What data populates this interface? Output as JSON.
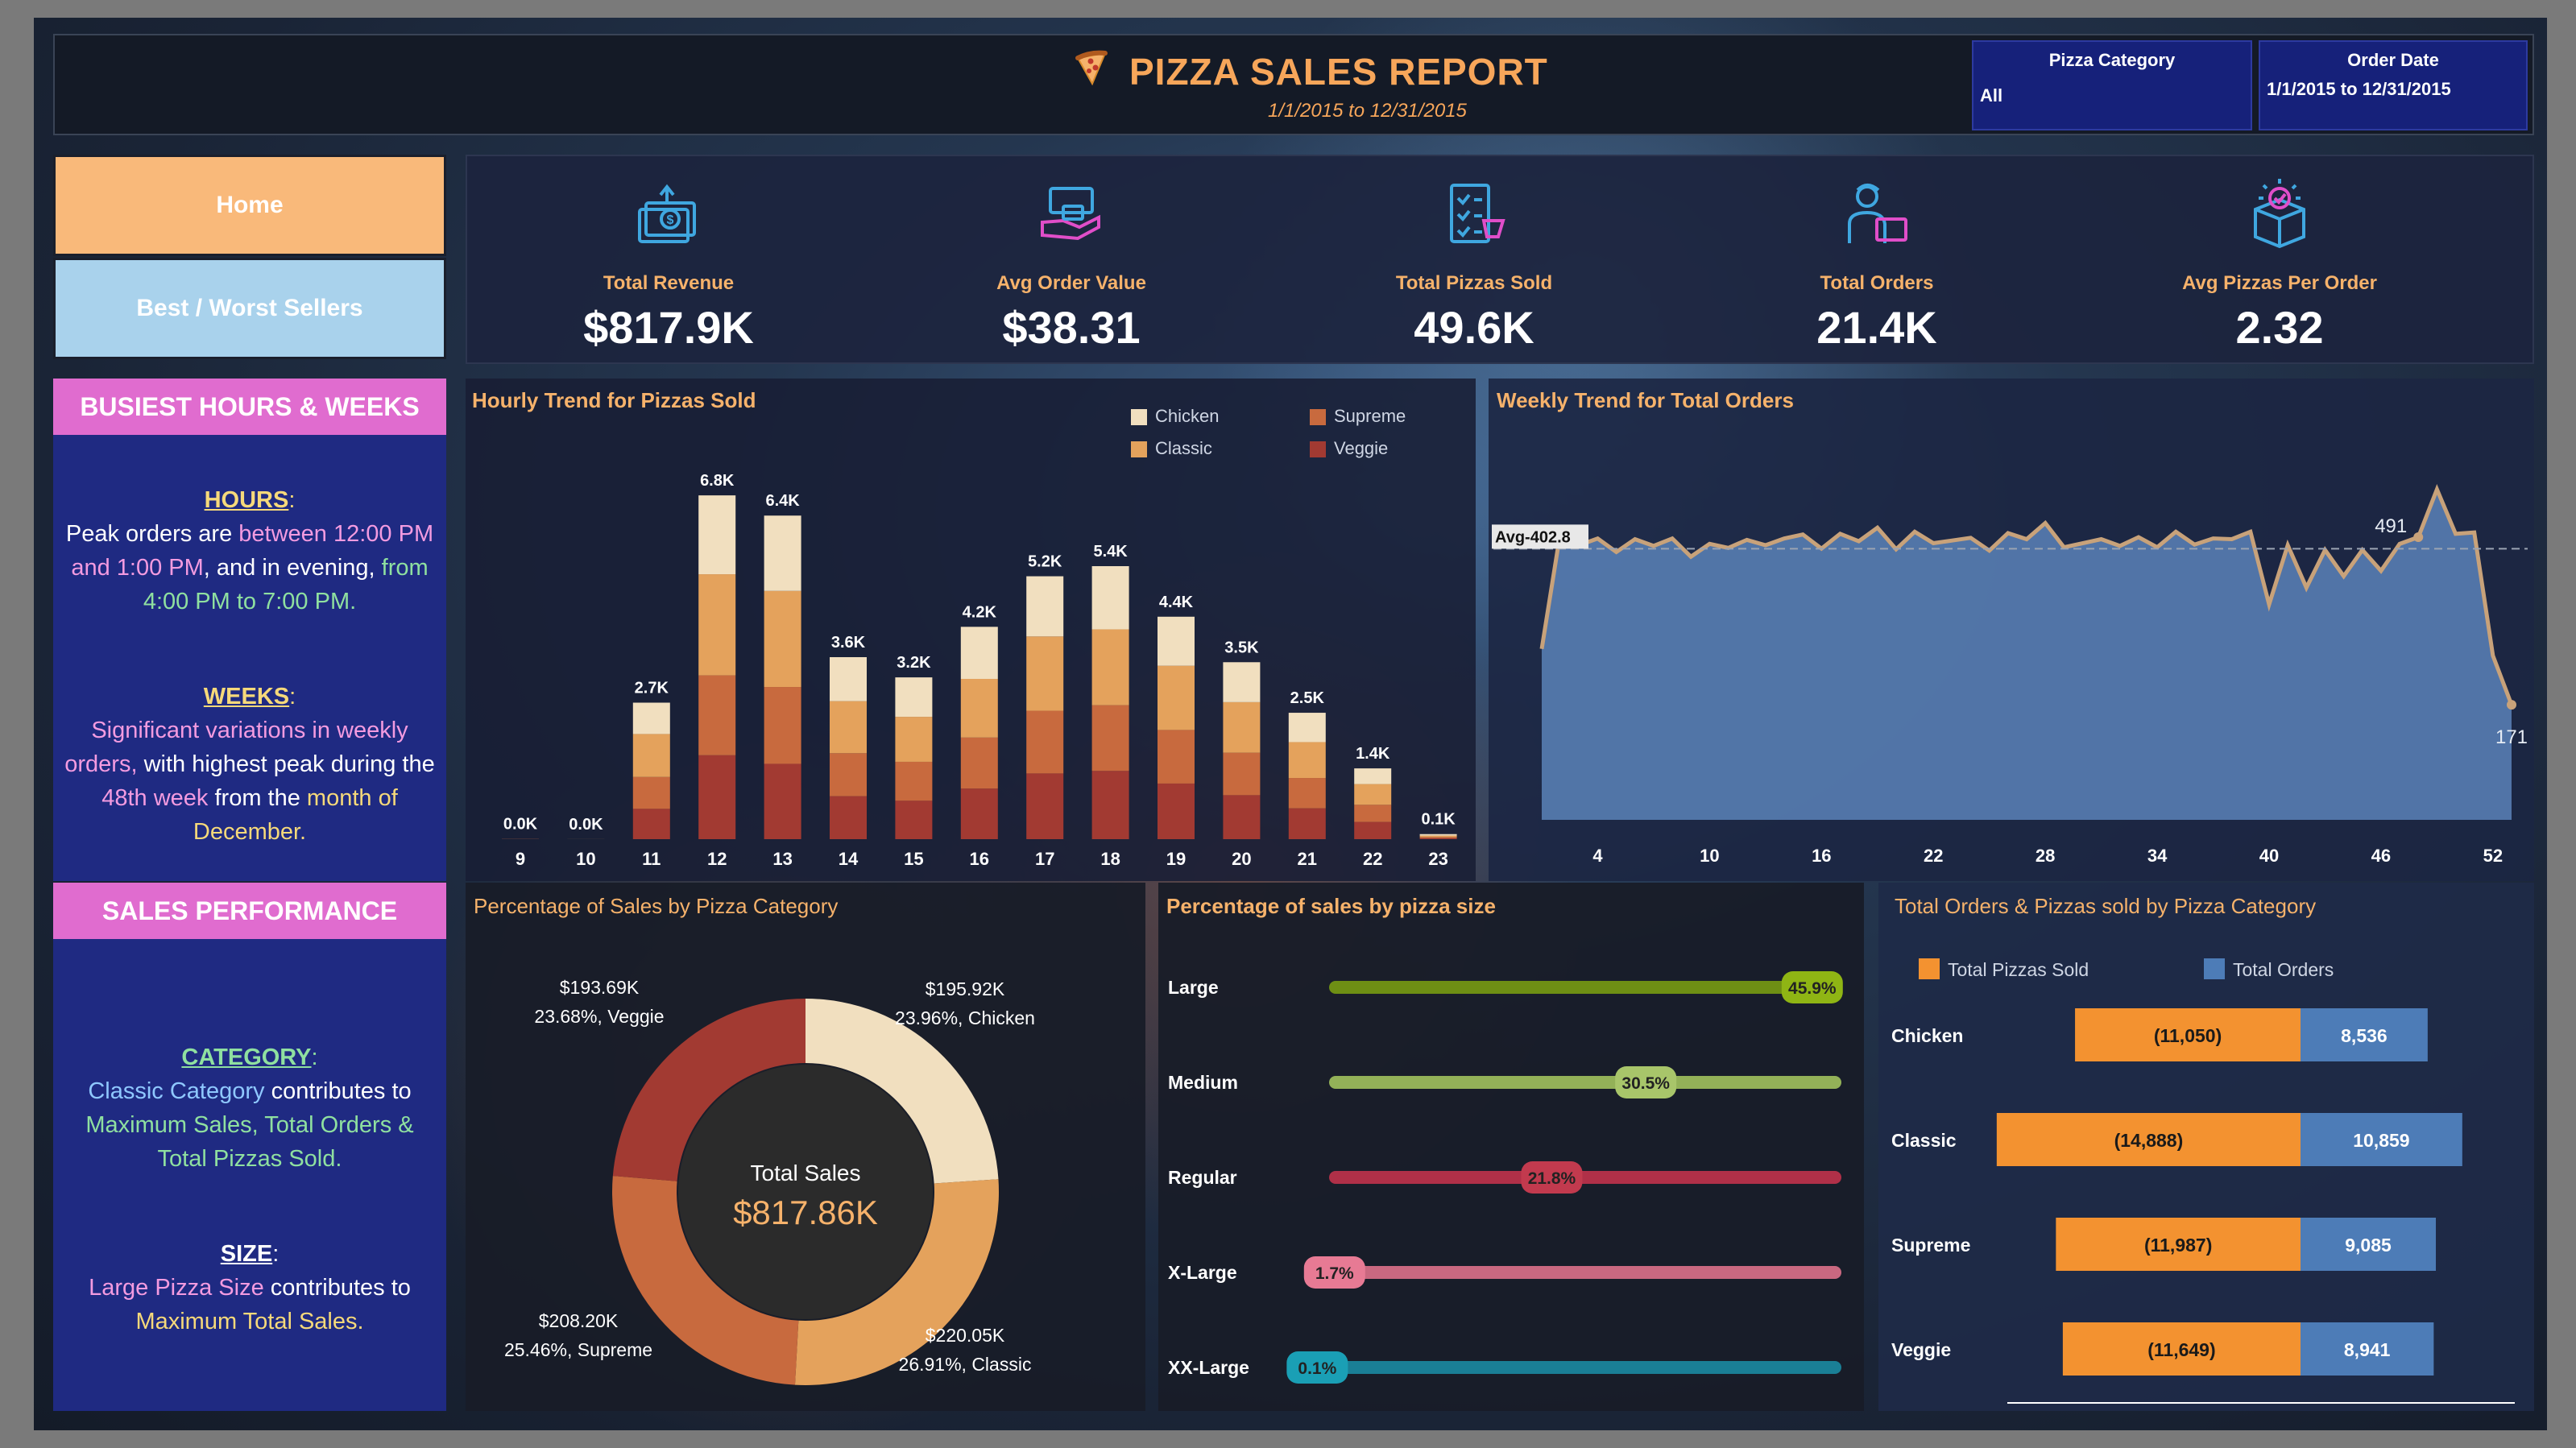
{
  "header": {
    "title": "PIZZA SALES REPORT",
    "subtitle": "1/1/2015 to 12/31/2015",
    "filters": [
      {
        "title": "Pizza Category",
        "value": "All"
      },
      {
        "title": "Order Date",
        "value": "1/1/2015 to 12/31/2015"
      }
    ]
  },
  "nav": {
    "home": "Home",
    "best_worst": "Best / Worst Sellers"
  },
  "kpis": [
    {
      "label": "Total Revenue",
      "value": "$817.9K",
      "icon": "revenue-icon"
    },
    {
      "label": "Avg Order Value",
      "value": "$38.31",
      "icon": "order-value-icon"
    },
    {
      "label": "Total Pizzas Sold",
      "value": "49.6K",
      "icon": "pizzas-sold-icon"
    },
    {
      "label": "Total Orders",
      "value": "21.4K",
      "icon": "orders-icon"
    },
    {
      "label": "Avg Pizzas Per Order",
      "value": "2.32",
      "icon": "pizzas-per-order-icon"
    }
  ],
  "insights": {
    "busiest_title": "BUSIEST HOURS & WEEKS",
    "hours_head": "HOURS",
    "hours_colon": ":",
    "hours_t1": "Peak orders are ",
    "hours_t2": "between 12:00 PM and 1:00 PM",
    "hours_t3": ", and in evening, ",
    "hours_t4": "from 4:00 PM to 7:00 PM.",
    "weeks_head": "WEEKS",
    "weeks_colon": ":",
    "weeks_t1": "Significant variations in weekly orders,",
    "weeks_t2": " with highest peak during the ",
    "weeks_t3": "48th week",
    "weeks_t4": " from the ",
    "weeks_t5": "month of December.",
    "sales_title": "SALES PERFORMANCE",
    "cat_head": "CATEGORY",
    "cat_colon": ":",
    "cat_t1": "Classic Category",
    "cat_t2": " contributes to ",
    "cat_t3": "Maximum Sales, Total Orders & Total Pizzas Sold.",
    "size_head": "SIZE",
    "size_colon": ":",
    "size_t1": "Large Pizza Size",
    "size_t2": " contributes to ",
    "size_t3": "Maximum Total Sales."
  },
  "chart_titles": {
    "hourly": "Hourly Trend for Pizzas Sold",
    "weekly": "Weekly Trend for Total Orders",
    "category": "Percentage of Sales by Pizza Category",
    "size": "Percentage of sales by pizza size",
    "orders_by_cat": "Total Orders & Pizzas sold by Pizza Category"
  },
  "chart_data": [
    {
      "type": "bar",
      "title": "Hourly Trend for Pizzas Sold",
      "stacked": true,
      "categories": [
        "9",
        "10",
        "11",
        "12",
        "13",
        "14",
        "15",
        "16",
        "17",
        "18",
        "19",
        "20",
        "21",
        "22",
        "23"
      ],
      "totals_labels": [
        "0.0K",
        "0.0K",
        "2.7K",
        "6.8K",
        "6.4K",
        "3.6K",
        "3.2K",
        "4.2K",
        "5.2K",
        "5.4K",
        "4.4K",
        "3.5K",
        "2.5K",
        "1.4K",
        "0.1K"
      ],
      "series": [
        {
          "name": "Veggie",
          "color": "#a23a32",
          "values": [
            2,
            0,
            600,
            1660,
            1490,
            850,
            760,
            1000,
            1300,
            1350,
            1100,
            870,
            610,
            340,
            20
          ]
        },
        {
          "name": "Supreme",
          "color": "#c86a3e",
          "values": [
            1,
            0,
            630,
            1580,
            1520,
            850,
            770,
            1010,
            1240,
            1300,
            1060,
            840,
            600,
            340,
            20
          ]
        },
        {
          "name": "Classic",
          "color": "#e4a25c",
          "values": [
            1,
            1,
            850,
            2000,
            1900,
            1030,
            890,
            1160,
            1470,
            1500,
            1270,
            1000,
            710,
            410,
            30
          ]
        },
        {
          "name": "Chicken",
          "color": "#f1dfbf",
          "values": [
            0,
            0,
            620,
            1560,
            1490,
            870,
            780,
            1030,
            1190,
            1250,
            970,
            790,
            580,
            310,
            30
          ]
        }
      ],
      "legend": "top-right"
    },
    {
      "type": "area",
      "title": "Weekly Trend for Total Orders",
      "x": [
        1,
        2,
        3,
        4,
        5,
        6,
        7,
        8,
        9,
        10,
        11,
        12,
        13,
        14,
        15,
        16,
        17,
        18,
        19,
        20,
        21,
        22,
        23,
        24,
        25,
        26,
        27,
        28,
        29,
        30,
        31,
        32,
        33,
        34,
        35,
        36,
        37,
        38,
        39,
        40,
        41,
        42,
        43,
        44,
        45,
        46,
        47,
        48,
        49,
        50,
        51,
        52,
        53
      ],
      "values": [
        254,
        427,
        408,
        418,
        398,
        417,
        407,
        418,
        391,
        410,
        404,
        416,
        408,
        418,
        424,
        403,
        425,
        414,
        434,
        402,
        428,
        411,
        415,
        419,
        400,
        426,
        417,
        441,
        405,
        411,
        417,
        407,
        420,
        405,
        428,
        409,
        418,
        417,
        428,
        320,
        408,
        345,
        401,
        362,
        401,
        370,
        410,
        420,
        491,
        425,
        427,
        244,
        171
      ],
      "xticks": [
        4,
        10,
        16,
        22,
        28,
        34,
        40,
        46,
        52
      ],
      "reference_line": {
        "label": "Avg-402.8",
        "value": 402.8
      },
      "annotations": [
        {
          "x": 48,
          "label": "491"
        },
        {
          "x": 53,
          "label": "171"
        }
      ],
      "ylim": [
        0,
        560
      ]
    },
    {
      "type": "pie",
      "title": "Percentage of Sales by Pizza Category",
      "center_label": "Total Sales",
      "center_value": "$817.86K",
      "slices": [
        {
          "name": "Chicken",
          "value": 23.96,
          "amount": "$195.92K",
          "label": "23.96%, Chicken",
          "color": "#f1dfbf"
        },
        {
          "name": "Classic",
          "value": 26.91,
          "amount": "$220.05K",
          "label": "26.91%, Classic",
          "color": "#e4a25c"
        },
        {
          "name": "Supreme",
          "value": 25.46,
          "amount": "$208.20K",
          "label": "25.46%, Supreme",
          "color": "#c86a3e"
        },
        {
          "name": "Veggie",
          "value": 23.68,
          "amount": "$193.69K",
          "label": "23.68%, Veggie",
          "color": "#a23a32"
        }
      ]
    },
    {
      "type": "bar",
      "title": "Percentage of sales by pizza size",
      "categories": [
        "Large",
        "Medium",
        "Regular",
        "X-Large",
        "XX-Large"
      ],
      "values": [
        45.9,
        30.5,
        21.8,
        1.7,
        0.1
      ],
      "labels": [
        "45.9%",
        "30.5%",
        "21.8%",
        "1.7%",
        "0.1%"
      ],
      "colors": [
        "#8fb514",
        "#a8c56a",
        "#c23a4e",
        "#e77a94",
        "#1a9fb5"
      ],
      "track_colors": [
        "#6e8f14",
        "#93b158",
        "#b03048",
        "#c96880",
        "#1a7f96"
      ]
    },
    {
      "type": "bar",
      "title": "Total Orders & Pizzas sold by Pizza Category",
      "categories": [
        "Chicken",
        "Classic",
        "Supreme",
        "Veggie"
      ],
      "series": [
        {
          "name": "Total Pizzas Sold",
          "color": "#f39230",
          "values": [
            11050,
            14888,
            11987,
            11649
          ],
          "labels": [
            "(11,050)",
            "(14,888)",
            "(11,987)",
            "(11,649)"
          ]
        },
        {
          "name": "Total Orders",
          "color": "#4d7cb7",
          "values": [
            8536,
            10859,
            9085,
            8941
          ],
          "labels": [
            "8,536",
            "10,859",
            "9,085",
            "8,941"
          ]
        }
      ],
      "xlim": [
        0,
        15000
      ]
    }
  ]
}
